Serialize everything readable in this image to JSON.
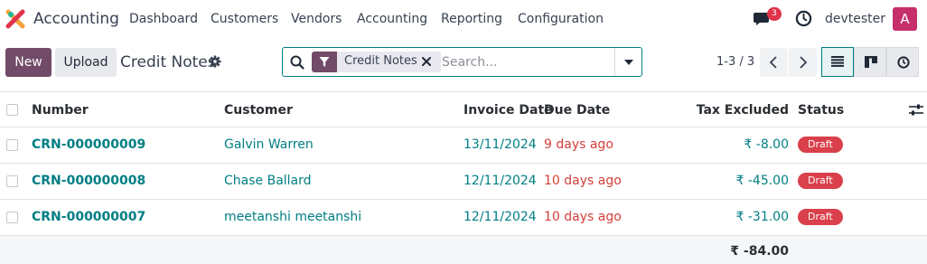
{
  "app": {
    "name": "Accounting"
  },
  "nav": {
    "items": [
      "Dashboard",
      "Customers",
      "Vendors",
      "Accounting",
      "Reporting",
      "Configuration"
    ]
  },
  "systray": {
    "messages_count": "3",
    "username": "devtester",
    "avatar_letter": "A"
  },
  "toolbar": {
    "new_label": "New",
    "upload_label": "Upload",
    "title": "Credit Notes"
  },
  "search": {
    "facet_label": "Credit Notes",
    "placeholder": "Search..."
  },
  "pager": {
    "value": "1-3 / 3"
  },
  "table": {
    "columns": [
      "Number",
      "Customer",
      "Invoice Date",
      "Due Date",
      "Tax Excluded",
      "Status"
    ],
    "rows": [
      {
        "number": "CRN-000000009",
        "customer": "Galvin Warren",
        "invoice_date": "13/11/2024",
        "due_date": "9 days ago",
        "tax_excluded": "₹ -8.00",
        "status": "Draft"
      },
      {
        "number": "CRN-000000008",
        "customer": "Chase Ballard",
        "invoice_date": "12/11/2024",
        "due_date": "10 days ago",
        "tax_excluded": "₹ -45.00",
        "status": "Draft"
      },
      {
        "number": "CRN-000000007",
        "customer": "meetanshi meetanshi",
        "invoice_date": "12/11/2024",
        "due_date": "10 days ago",
        "tax_excluded": "₹ -31.00",
        "status": "Draft"
      }
    ],
    "total": "₹ -84.00"
  },
  "colors": {
    "brand": "#714b67",
    "accent": "#017e84",
    "danger": "#d9404b"
  }
}
